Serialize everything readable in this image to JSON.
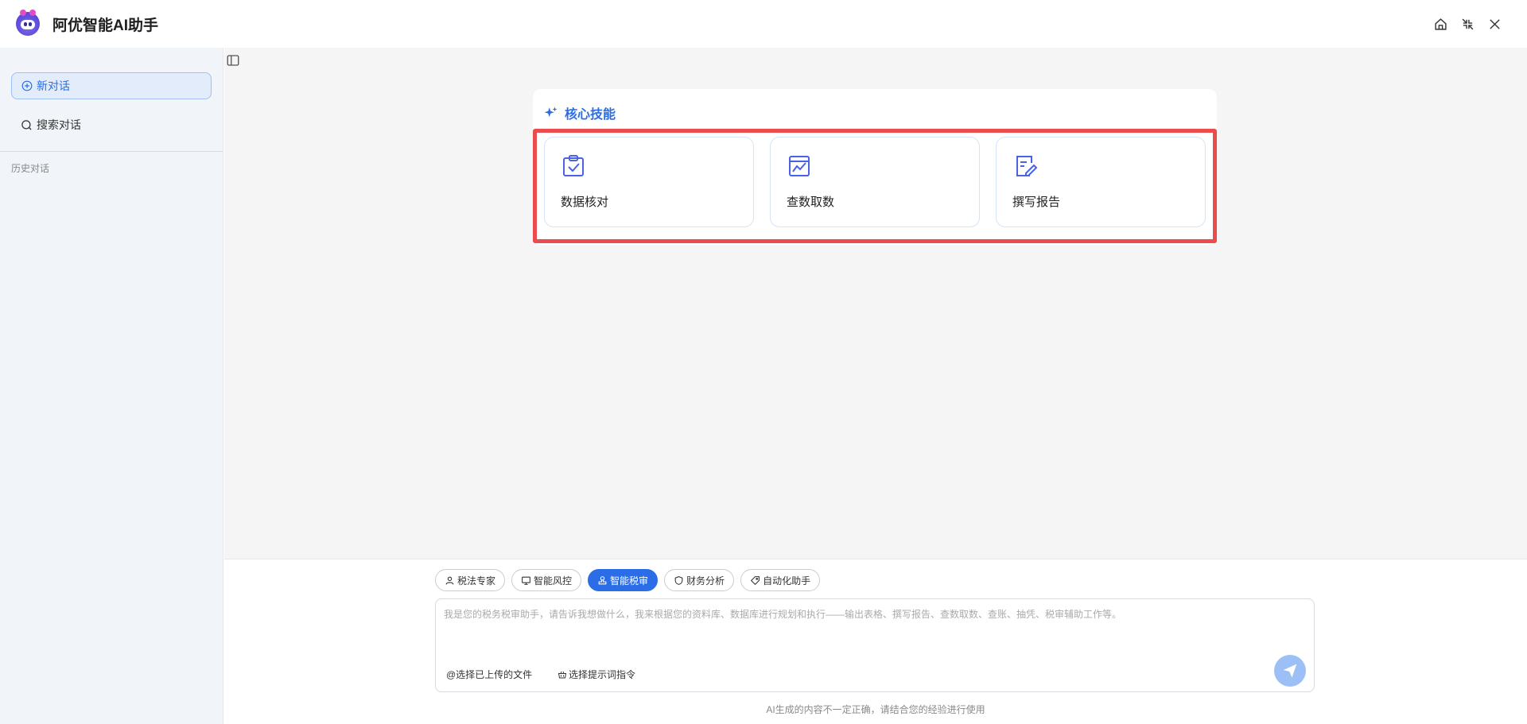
{
  "app": {
    "title": "阿优智能AI助手"
  },
  "window_controls": [
    "home-icon",
    "collapse-icon",
    "close-icon"
  ],
  "sidebar": {
    "new_chat_label": "新对话",
    "search_label": "搜索对话",
    "history_label": "历史对话"
  },
  "skills": {
    "title": "核心技能",
    "items": [
      {
        "label": "数据核对",
        "icon": "clipboard-check-icon"
      },
      {
        "label": "查数取数",
        "icon": "chart-line-icon"
      },
      {
        "label": "撰写报告",
        "icon": "edit-document-icon"
      }
    ]
  },
  "modes": [
    {
      "label": "税法专家",
      "icon": "user-icon",
      "active": false
    },
    {
      "label": "智能风控",
      "icon": "monitor-icon",
      "active": false
    },
    {
      "label": "智能税审",
      "icon": "stamp-icon",
      "active": true
    },
    {
      "label": "财务分析",
      "icon": "shield-icon",
      "active": false
    },
    {
      "label": "自动化助手",
      "icon": "tag-icon",
      "active": false
    }
  ],
  "input": {
    "placeholder": "我是您的税务税审助手，请告诉我想做什么，我来根据您的资料库、数据库进行规划和执行——输出表格、撰写报告、查数取数、查账、抽凭、税审辅助工作等。",
    "value": "",
    "attach_files_label": "@选择已上传的文件",
    "prompt_commands_label": "选择提示词指令"
  },
  "footer": {
    "disclaimer": "AI生成的内容不一定正确，请结合您的经验进行使用"
  },
  "colors": {
    "accent": "#2b6de6",
    "highlight": "#ea4c4c",
    "sidebar_bg": "#f1f5fa"
  }
}
